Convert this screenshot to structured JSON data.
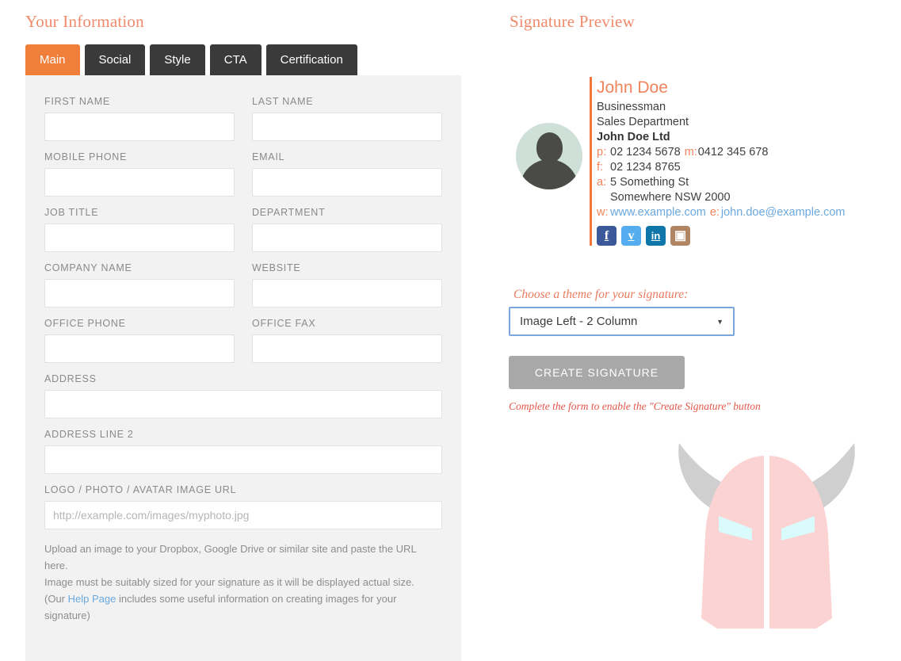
{
  "left": {
    "title": "Your Information",
    "tabs": [
      {
        "label": "Main",
        "active": true
      },
      {
        "label": "Social",
        "active": false
      },
      {
        "label": "Style",
        "active": false
      },
      {
        "label": "CTA",
        "active": false
      },
      {
        "label": "Certification",
        "active": false
      }
    ],
    "fields": [
      {
        "label": "FIRST NAME",
        "value": "",
        "placeholder": "",
        "width": "half"
      },
      {
        "label": "LAST NAME",
        "value": "",
        "placeholder": "",
        "width": "half"
      },
      {
        "label": "MOBILE PHONE",
        "value": "",
        "placeholder": "",
        "width": "half"
      },
      {
        "label": "EMAIL",
        "value": "",
        "placeholder": "",
        "width": "half"
      },
      {
        "label": "JOB TITLE",
        "value": "",
        "placeholder": "",
        "width": "half"
      },
      {
        "label": "DEPARTMENT",
        "value": "",
        "placeholder": "",
        "width": "half"
      },
      {
        "label": "COMPANY NAME",
        "value": "",
        "placeholder": "",
        "width": "half"
      },
      {
        "label": "WEBSITE",
        "value": "",
        "placeholder": "",
        "width": "half"
      },
      {
        "label": "OFFICE PHONE",
        "value": "",
        "placeholder": "",
        "width": "half"
      },
      {
        "label": "OFFICE FAX",
        "value": "",
        "placeholder": "",
        "width": "half"
      },
      {
        "label": "ADDRESS",
        "value": "",
        "placeholder": "",
        "width": "full"
      },
      {
        "label": "ADDRESS LINE 2",
        "value": "",
        "placeholder": "",
        "width": "full"
      },
      {
        "label": "LOGO / PHOTO / AVATAR IMAGE URL",
        "value": "",
        "placeholder": "http://example.com/images/myphoto.jpg",
        "width": "full"
      }
    ],
    "help": {
      "line1": "Upload an image to your Dropbox, Google Drive or similar site and paste the URL here.",
      "line2": "Image must be suitably sized for your signature as it will be displayed actual size.",
      "line3_pre": "(Our ",
      "line3_link": "Help Page",
      "line3_post": " includes some useful information on creating images for your signature)"
    }
  },
  "right": {
    "title": "Signature Preview",
    "signature": {
      "name": "John Doe",
      "job_title": "Businessman",
      "department": "Sales Department",
      "company": "John Doe Ltd",
      "phone_label": "p:",
      "phone": "02 1234 5678",
      "mobile_label": "m:",
      "mobile": "0412 345 678",
      "fax_label": "f:",
      "fax": "02 1234 8765",
      "address_label": "a:",
      "address_line1": "5 Something St",
      "address_line2": "Somewhere NSW 2000",
      "web_label": "w:",
      "website": "www.example.com",
      "email_label": "e:",
      "email": "john.doe@example.com",
      "socials": [
        "facebook",
        "twitter",
        "linkedin",
        "instagram"
      ]
    },
    "theme_label": "Choose a theme for your signature:",
    "theme_selected": "Image Left - 2 Column",
    "create_button": "CREATE SIGNATURE",
    "warning": "Complete the form to enable the \"Create Signature\" button"
  },
  "colors": {
    "accent_orange": "#f07f3c",
    "heading_salmon": "#f08a6a",
    "tab_dark": "#3a3a3a",
    "link_blue": "#6aa8dd",
    "warn_red": "#e5574a",
    "helmet_pink": "#fcd3d3",
    "helmet_horn": "#cfcfcf",
    "helmet_eye": "#d9fbfb"
  }
}
